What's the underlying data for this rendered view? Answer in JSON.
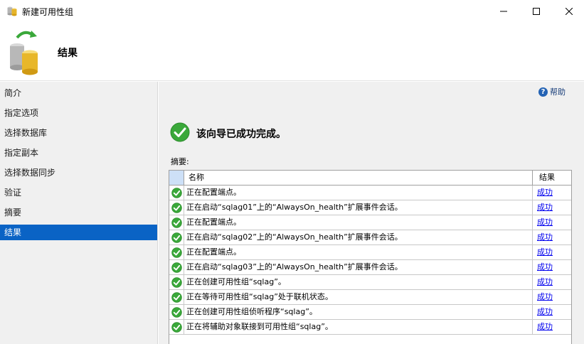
{
  "window": {
    "title": "新建可用性组",
    "app_icon": "database-cylinders-icon",
    "controls": [
      "minimize-icon",
      "maximize-icon",
      "close-icon"
    ]
  },
  "header": {
    "title": "结果",
    "icon": "database-sync-icon"
  },
  "sidebar": {
    "items": [
      {
        "label": "简介"
      },
      {
        "label": "指定选项"
      },
      {
        "label": "选择数据库"
      },
      {
        "label": "指定副本"
      },
      {
        "label": "选择数据同步"
      },
      {
        "label": "验证"
      },
      {
        "label": "摘要"
      },
      {
        "label": "结果",
        "selected": true
      }
    ]
  },
  "main": {
    "help_label": "帮助",
    "status_message": "该向导已成功完成。",
    "summary_label": "摘要:",
    "table": {
      "columns": [
        "名称",
        "结果"
      ],
      "rows": [
        {
          "name": "正在配置端点。",
          "result": "成功"
        },
        {
          "name": "正在启动“sqlag01”上的“AlwaysOn_health”扩展事件会话。",
          "result": "成功"
        },
        {
          "name": "正在配置端点。",
          "result": "成功"
        },
        {
          "name": "正在启动“sqlag02”上的“AlwaysOn_health”扩展事件会话。",
          "result": "成功"
        },
        {
          "name": "正在配置端点。",
          "result": "成功"
        },
        {
          "name": "正在启动“sqlag03”上的“AlwaysOn_health”扩展事件会话。",
          "result": "成功"
        },
        {
          "name": "正在创建可用性组“sqlag”。",
          "result": "成功"
        },
        {
          "name": "正在等待可用性组“sqlag”处于联机状态。",
          "result": "成功"
        },
        {
          "name": "正在创建可用性组侦听程序“sqlag”。",
          "result": "成功"
        },
        {
          "name": "正在将辅助对象联接到可用性组“sqlag”。",
          "result": "成功"
        }
      ]
    }
  },
  "colors": {
    "selected_nav": "#0a63c5",
    "success_green": "#3aa83a",
    "link_blue": "#0000ee",
    "panel_bg": "#f0f0f0"
  }
}
